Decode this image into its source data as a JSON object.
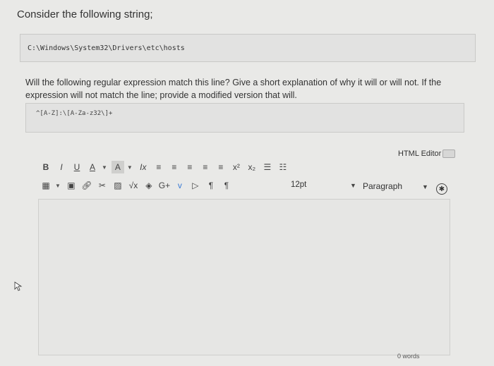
{
  "question": {
    "prompt": "Consider the following string;",
    "code_string": "C:\\Windows\\System32\\Drivers\\etc\\hosts",
    "instructions": "Will the following regular expression match this line? Give a short explanation of why it will or will not. If the expression will not match the line; provide a modified version that will.",
    "regex": "^[A-Z]:\\[A-Za-z32\\]+"
  },
  "editor": {
    "html_editor_label": "HTML Editor",
    "toolbar_row1": [
      "B",
      "I",
      "U",
      "A",
      "A",
      "Ix",
      "≡",
      "≡",
      "≡",
      "≡",
      "≡",
      "x²",
      "x₂",
      "list",
      "numbered-list"
    ],
    "toolbar_row2": [
      "table",
      "media",
      "link",
      "unlink",
      "image",
      "√x",
      "layers",
      "G+",
      "v",
      "embed",
      "¶",
      "¶"
    ],
    "font_size": "12pt",
    "block_format": "Paragraph",
    "word_count": "0 words"
  }
}
